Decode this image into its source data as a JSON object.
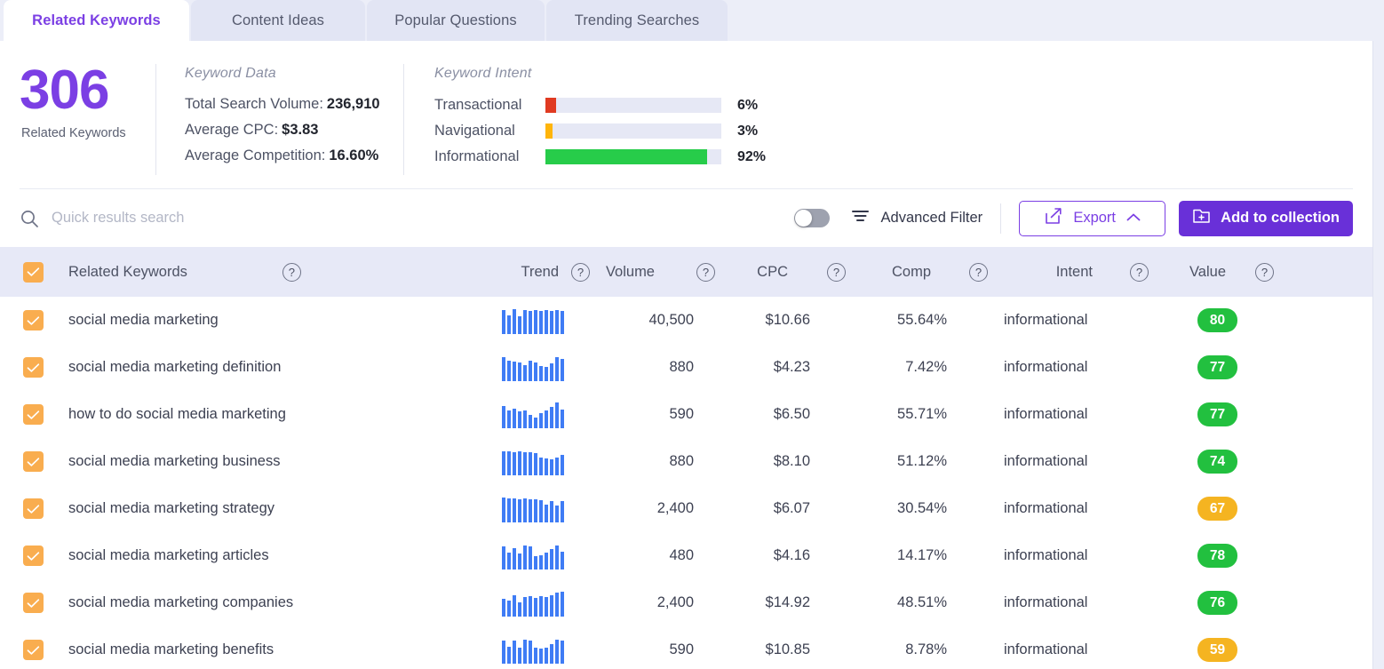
{
  "tabs": [
    {
      "label": "Related Keywords",
      "active": true
    },
    {
      "label": "Content Ideas",
      "active": false
    },
    {
      "label": "Popular Questions",
      "active": false
    },
    {
      "label": "Trending Searches",
      "active": false
    }
  ],
  "summary": {
    "count": "306",
    "count_label": "Related Keywords",
    "keyword_data": {
      "title": "Keyword Data",
      "rows": [
        {
          "label": "Total Search Volume:",
          "value": "236,910"
        },
        {
          "label": "Average CPC:",
          "value": "$3.83"
        },
        {
          "label": "Average Competition:",
          "value": "16.60%"
        }
      ]
    },
    "keyword_intent": {
      "title": "Keyword Intent",
      "rows": [
        {
          "name": "Transactional",
          "percent": "6%",
          "value": 6,
          "color": "#e03a21"
        },
        {
          "name": "Navigational",
          "percent": "3%",
          "value": 3,
          "color": "#ffb50a"
        },
        {
          "name": "Informational",
          "percent": "92%",
          "value": 92,
          "color": "#27cc4a"
        }
      ]
    }
  },
  "toolbar": {
    "search_placeholder": "Quick results search",
    "search_value": "",
    "toggle_on": false,
    "advanced_filter_label": "Advanced Filter",
    "export_label": "Export",
    "add_to_collection_label": "Add to collection"
  },
  "table": {
    "select_all_checked": true,
    "columns": [
      {
        "key": "keyword",
        "label": "Related Keywords",
        "help": true
      },
      {
        "key": "trend",
        "label": "Trend",
        "help": true
      },
      {
        "key": "volume",
        "label": "Volume",
        "help": true
      },
      {
        "key": "cpc",
        "label": "CPC",
        "help": true
      },
      {
        "key": "comp",
        "label": "Comp",
        "help": true
      },
      {
        "key": "intent",
        "label": "Intent",
        "help": true
      },
      {
        "key": "value",
        "label": "Value",
        "help": true
      }
    ],
    "help_glyph": "?",
    "rows": [
      {
        "checked": true,
        "keyword": "social media marketing",
        "trend": [
          88,
          70,
          92,
          66,
          90,
          86,
          88,
          84,
          90,
          86,
          88,
          84
        ],
        "volume": "40,500",
        "cpc": "$10.66",
        "comp": "55.64%",
        "intent": "informational",
        "value": "80",
        "value_color": "#22c03f"
      },
      {
        "checked": true,
        "keyword": "social media marketing definition",
        "trend": [
          90,
          74,
          72,
          70,
          58,
          76,
          70,
          56,
          52,
          66,
          88,
          82
        ],
        "volume": "880",
        "cpc": "$4.23",
        "comp": "7.42%",
        "intent": "informational",
        "value": "77",
        "value_color": "#22c03f"
      },
      {
        "checked": true,
        "keyword": "how to do social media marketing",
        "trend": [
          82,
          66,
          72,
          62,
          64,
          48,
          40,
          56,
          66,
          78,
          96,
          70
        ],
        "volume": "590",
        "cpc": "$6.50",
        "comp": "55.71%",
        "intent": "informational",
        "value": "77",
        "value_color": "#22c03f"
      },
      {
        "checked": true,
        "keyword": "social media marketing business",
        "trend": [
          90,
          88,
          86,
          88,
          84,
          86,
          82,
          66,
          62,
          60,
          64,
          76
        ],
        "volume": "880",
        "cpc": "$8.10",
        "comp": "51.12%",
        "intent": "informational",
        "value": "74",
        "value_color": "#22c03f"
      },
      {
        "checked": true,
        "keyword": "social media marketing strategy",
        "trend": [
          92,
          88,
          90,
          86,
          88,
          84,
          86,
          82,
          64,
          78,
          62,
          80
        ],
        "volume": "2,400",
        "cpc": "$6.07",
        "comp": "30.54%",
        "intent": "informational",
        "value": "67",
        "value_color": "#f5b421"
      },
      {
        "checked": true,
        "keyword": "social media marketing articles",
        "trend": [
          84,
          62,
          78,
          58,
          88,
          84,
          48,
          52,
          62,
          74,
          90,
          64
        ],
        "volume": "480",
        "cpc": "$4.16",
        "comp": "14.17%",
        "intent": "informational",
        "value": "78",
        "value_color": "#22c03f"
      },
      {
        "checked": true,
        "keyword": "social media marketing companies",
        "trend": [
          66,
          58,
          80,
          52,
          72,
          74,
          70,
          76,
          72,
          78,
          88,
          92
        ],
        "volume": "2,400",
        "cpc": "$14.92",
        "comp": "48.51%",
        "intent": "informational",
        "value": "76",
        "value_color": "#22c03f"
      },
      {
        "checked": true,
        "keyword": "social media marketing benefits",
        "trend": [
          84,
          62,
          86,
          60,
          88,
          84,
          58,
          54,
          60,
          72,
          88,
          84
        ],
        "volume": "590",
        "cpc": "$10.85",
        "comp": "8.78%",
        "intent": "informational",
        "value": "59",
        "value_color": "#f5b421"
      }
    ]
  }
}
